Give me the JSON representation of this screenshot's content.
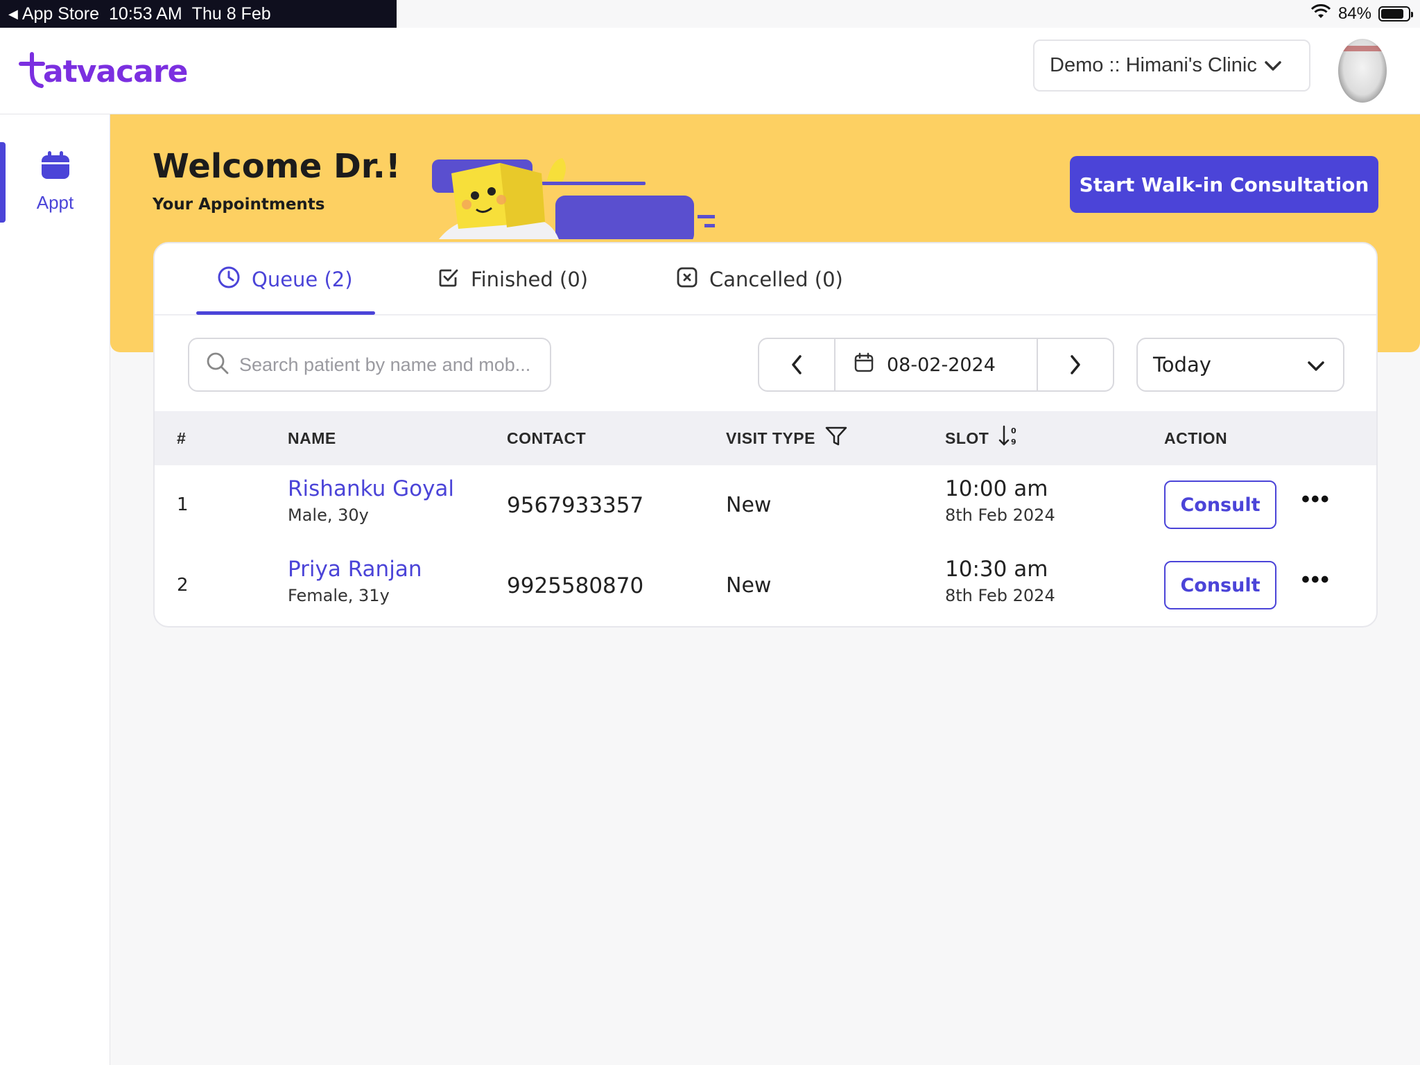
{
  "status_bar": {
    "back_app": "App Store",
    "time": "10:53 AM",
    "date": "Thu 8 Feb",
    "battery": "84%"
  },
  "header": {
    "logo_text": "atvacare",
    "clinic": "Demo :: Himani's Clinic"
  },
  "sidebar": {
    "items": [
      {
        "label": "Appt",
        "icon": "calendar-icon"
      }
    ]
  },
  "banner": {
    "welcome": "Welcome Dr.!",
    "subtitle": "Your Appointments",
    "cta": "Start Walk-in Consultation"
  },
  "tabs": [
    {
      "label": "Queue (2)",
      "icon": "clock-icon"
    },
    {
      "label": "Finished (0)",
      "icon": "checkbox-icon"
    },
    {
      "label": "Cancelled (0)",
      "icon": "x-box-icon"
    }
  ],
  "search": {
    "placeholder": "Search patient by name and mob..."
  },
  "date_nav": {
    "date": "08-02-2024"
  },
  "range": {
    "selected": "Today"
  },
  "table": {
    "headers": [
      "#",
      "NAME",
      "CONTACT",
      "VISIT TYPE",
      "SLOT",
      "ACTION"
    ],
    "rows": [
      {
        "index": "1",
        "name": "Rishanku Goyal",
        "info": "Male, 30y",
        "contact": "9567933357",
        "visit_type": "New",
        "slot_time": "10:00 am",
        "slot_date": "8th Feb 2024",
        "action": "Consult"
      },
      {
        "index": "2",
        "name": "Priya Ranjan",
        "info": "Female, 31y",
        "contact": "9925580870",
        "visit_type": "New",
        "slot_time": "10:30 am",
        "slot_date": "8th Feb 2024",
        "action": "Consult"
      }
    ]
  },
  "colors": {
    "brand": "#7b2fe0",
    "primary": "#4b44d8",
    "banner": "#fdd062"
  }
}
